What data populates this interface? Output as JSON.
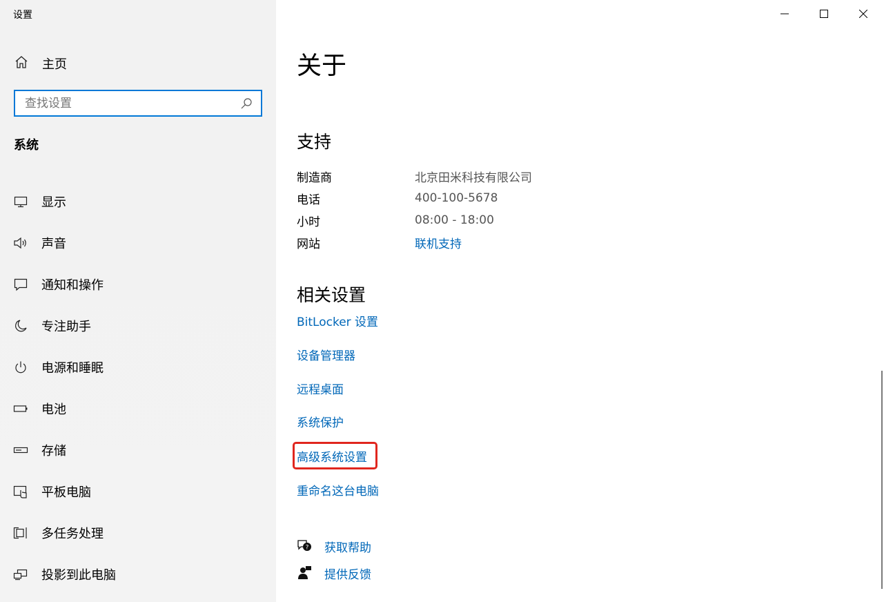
{
  "app": {
    "title": "设置"
  },
  "sidebar": {
    "home_label": "主页",
    "search_placeholder": "查找设置",
    "section_title": "系统",
    "items": [
      {
        "label": "显示",
        "icon": "monitor-icon"
      },
      {
        "label": "声音",
        "icon": "speaker-icon"
      },
      {
        "label": "通知和操作",
        "icon": "notification-icon"
      },
      {
        "label": "专注助手",
        "icon": "moon-icon"
      },
      {
        "label": "电源和睡眠",
        "icon": "power-icon"
      },
      {
        "label": "电池",
        "icon": "battery-icon"
      },
      {
        "label": "存储",
        "icon": "storage-icon"
      },
      {
        "label": "平板电脑",
        "icon": "tablet-icon"
      },
      {
        "label": "多任务处理",
        "icon": "multitask-icon"
      },
      {
        "label": "投影到此电脑",
        "icon": "project-icon"
      }
    ]
  },
  "main": {
    "title": "关于",
    "support": {
      "heading": "支持",
      "rows": [
        {
          "key": "制造商",
          "value": "北京田米科技有限公司"
        },
        {
          "key": "电话",
          "value": "400-100-5678"
        },
        {
          "key": "小时",
          "value": "08:00 - 18:00"
        },
        {
          "key": "网站",
          "value": "联机支持"
        }
      ]
    },
    "related": {
      "heading": "相关设置",
      "links": [
        "BitLocker 设置",
        "设备管理器",
        "远程桌面",
        "系统保护",
        "高级系统设置",
        "重命名这台电脑"
      ]
    },
    "help": {
      "get_help": "获取帮助",
      "feedback": "提供反馈"
    }
  },
  "colors": {
    "accent": "#0067b8",
    "search_border": "#0078d7",
    "highlight": "#e0261e"
  }
}
